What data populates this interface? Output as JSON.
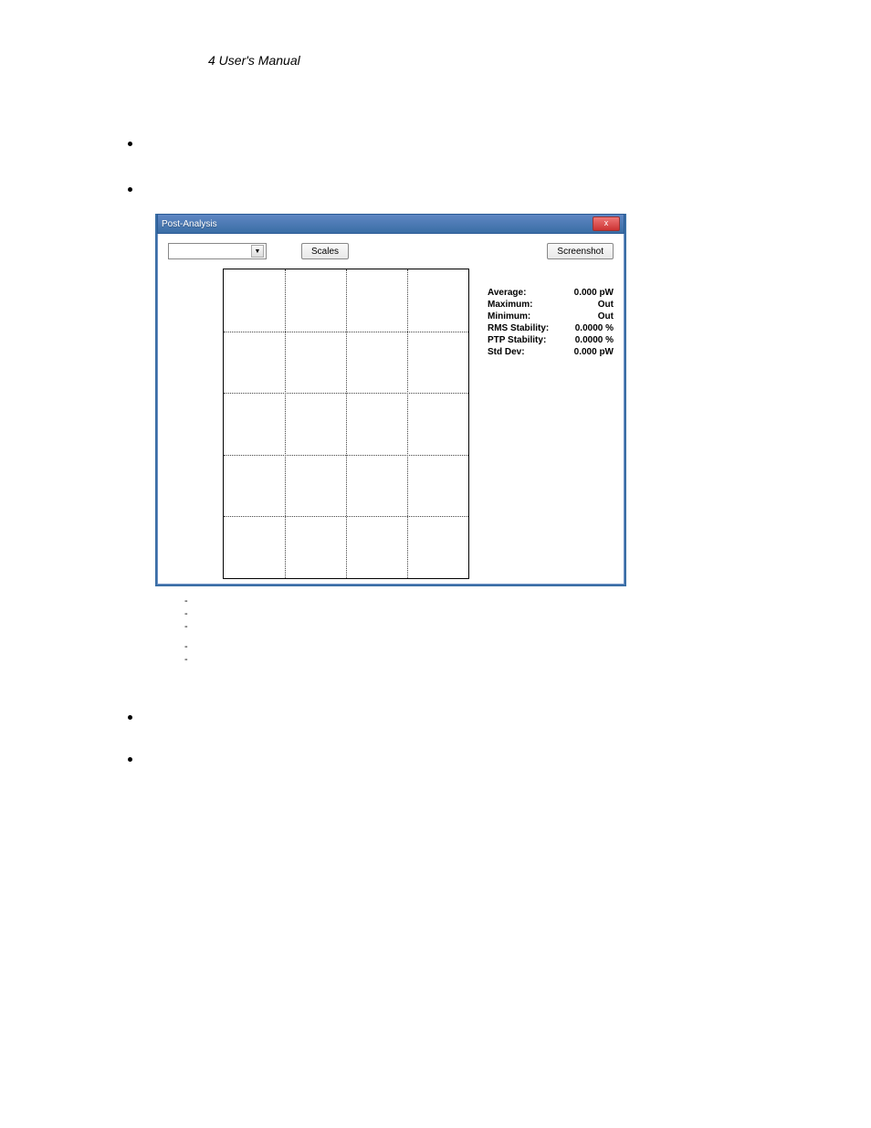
{
  "header": {
    "title": "4 User's Manual"
  },
  "bullets": {
    "b1": "",
    "b2": "",
    "b3": "",
    "b4": ""
  },
  "dashes": [
    "",
    "",
    "",
    "",
    ""
  ],
  "screenshot": {
    "window_title": "Post-Analysis",
    "close_glyph": "x",
    "dropdown_value": "",
    "scales_button": "Scales",
    "screenshot_button": "Screenshot",
    "stats": [
      {
        "label": "Average:",
        "value": "0.000 pW"
      },
      {
        "label": "Maximum:",
        "value": "Out"
      },
      {
        "label": "Minimum:",
        "value": "Out"
      },
      {
        "label": "RMS Stability:",
        "value": "0.0000 %"
      },
      {
        "label": "PTP Stability:",
        "value": "0.0000 %"
      },
      {
        "label": "Std Dev:",
        "value": "0.000 pW"
      }
    ]
  },
  "chart_data": {
    "type": "line",
    "title": "",
    "xlabel": "",
    "ylabel": "",
    "x_ticks": 4,
    "y_ticks": 5,
    "series": []
  }
}
